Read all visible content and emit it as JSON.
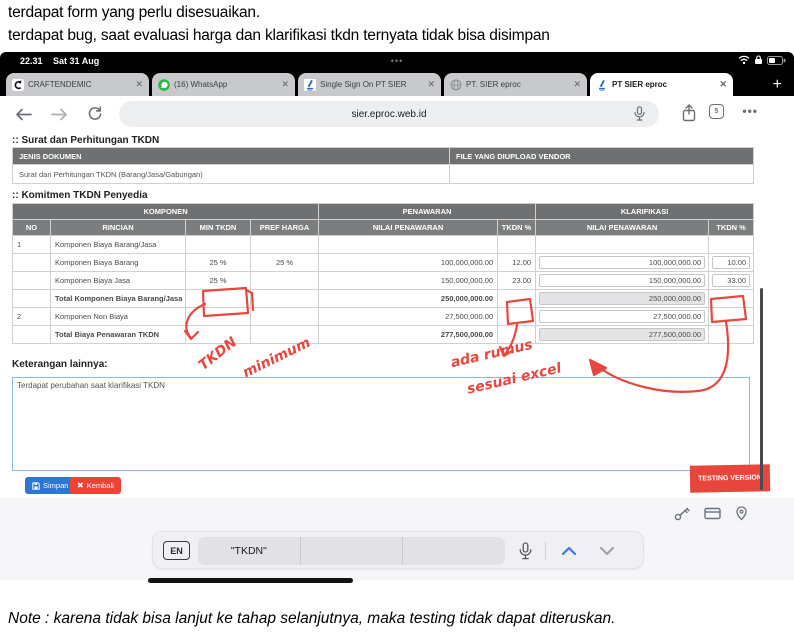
{
  "annotations": {
    "top_line1": "terdapat form yang perlu disesuaikan.",
    "top_line2": "terdapat bug, saat evaluasi harga dan klarifikasi tkdn ternyata tidak bisa disimpan",
    "bottom_note": "Note : karena tidak bisa lanjut ke tahap selanjutnya, maka testing tidak dapat diteruskan.",
    "handwritten": {
      "left_word1": "TKDN",
      "left_word2": "minimum",
      "right_word1": "ada rumus",
      "right_word2": "sesuai excel"
    }
  },
  "status_bar": {
    "time": "22.31",
    "date": "Sat 31 Aug",
    "dots": "•••"
  },
  "tab_bar": {
    "close_glyph": "✕",
    "new_tab_label": "+",
    "tabs": [
      {
        "title": "CRAFTENDEMIC",
        "icon": "craftendemic",
        "active": false
      },
      {
        "title": "(16) WhatsApp",
        "icon": "whatsapp",
        "active": false
      },
      {
        "title": "Single Sign On PT SIER",
        "icon": "sier",
        "active": false
      },
      {
        "title": "PT. SIER eproc",
        "icon": "globe",
        "active": false
      },
      {
        "title": "PT SIER eproc",
        "icon": "sier",
        "active": true
      }
    ]
  },
  "toolbar": {
    "url": "sier.eproc.web.id",
    "tab_count": "5",
    "more_glyph": "•••"
  },
  "page": {
    "section1_title": ":: Surat dan Perhitungan TKDN",
    "table1": {
      "headers": [
        "JENIS DOKUMEN",
        "FILE YANG DIUPLOAD VENDOR"
      ],
      "rows": [
        [
          "Surat dan Perhitungan TKDN (Barang/Jasa/Gabungan)",
          ""
        ]
      ]
    },
    "section2_title": ":: Komitmen TKDN Penyedia",
    "table2": {
      "group_headers": [
        "KOMPONEN",
        "PENAWARAN",
        "KLARIFIKASI"
      ],
      "sub_headers": [
        "NO",
        "RINCIAN",
        "MIN TKDN",
        "PREF HARGA",
        "NILAI PENAWARAN",
        "TKDN %",
        "NILAI PENAWARAN",
        "TKDN %"
      ],
      "rows": [
        {
          "cells": [
            "1",
            "Komponen Biaya Barang/Jasa",
            "",
            "",
            "",
            ""
          ],
          "klar": [
            null,
            null
          ],
          "bold": false
        },
        {
          "cells": [
            "",
            "Komponen Biaya Barang",
            "25 %",
            "25 %",
            "100,000,000.00",
            "12.00"
          ],
          "klar": [
            {
              "v": "100,000,000.00",
              "disabled": false
            },
            {
              "v": "10.00",
              "disabled": false
            }
          ],
          "bold": false
        },
        {
          "cells": [
            "",
            "Komponen Biaya Jasa",
            "25 %",
            "",
            "150,000,000.00",
            "23.00"
          ],
          "klar": [
            {
              "v": "150,000,000.00",
              "disabled": false
            },
            {
              "v": "33.00",
              "disabled": false
            }
          ],
          "bold": false
        },
        {
          "cells": [
            "",
            "Total Komponen Biaya Barang/Jasa",
            "",
            "",
            "250,000,000.00",
            ""
          ],
          "klar": [
            {
              "v": "250,000,000.00",
              "disabled": true
            },
            null
          ],
          "bold": true
        },
        {
          "cells": [
            "2",
            "Komponen Non Biaya",
            "",
            "",
            "27,500,000.00",
            ""
          ],
          "klar": [
            {
              "v": "27,500,000.00",
              "disabled": false
            },
            null
          ],
          "bold": false
        },
        {
          "cells": [
            "",
            "Total Biaya Penawaran TKDN",
            "",
            "",
            "277,500,000.00",
            ""
          ],
          "klar": [
            {
              "v": "277,500,000.00",
              "disabled": true
            },
            null
          ],
          "bold": true
        }
      ]
    },
    "keterangan_label": "Keterangan lainnya:",
    "keterangan_value": "Terdapat perubahan saat klarifikasi TKDN",
    "save_button": "Simpan",
    "back_button": "Kembali",
    "testing_badge": "TESTING VERSION"
  },
  "keyboard_bar": {
    "lang": "EN",
    "suggestion1": "\"TKDN\"",
    "suggestion2": "",
    "suggestion3": ""
  },
  "colors": {
    "table_header_gray": "#6e7072",
    "table_subheader_gray": "#7b7d7f",
    "annotation_red": "#e8473f",
    "save_blue": "#2d76d2",
    "back_red": "#ee4437",
    "badge_red": "#e8463c",
    "whatsapp_green": "#2bb741",
    "sier_blue": "#2f6fb8",
    "focus_border_blue": "#85bbe8"
  }
}
